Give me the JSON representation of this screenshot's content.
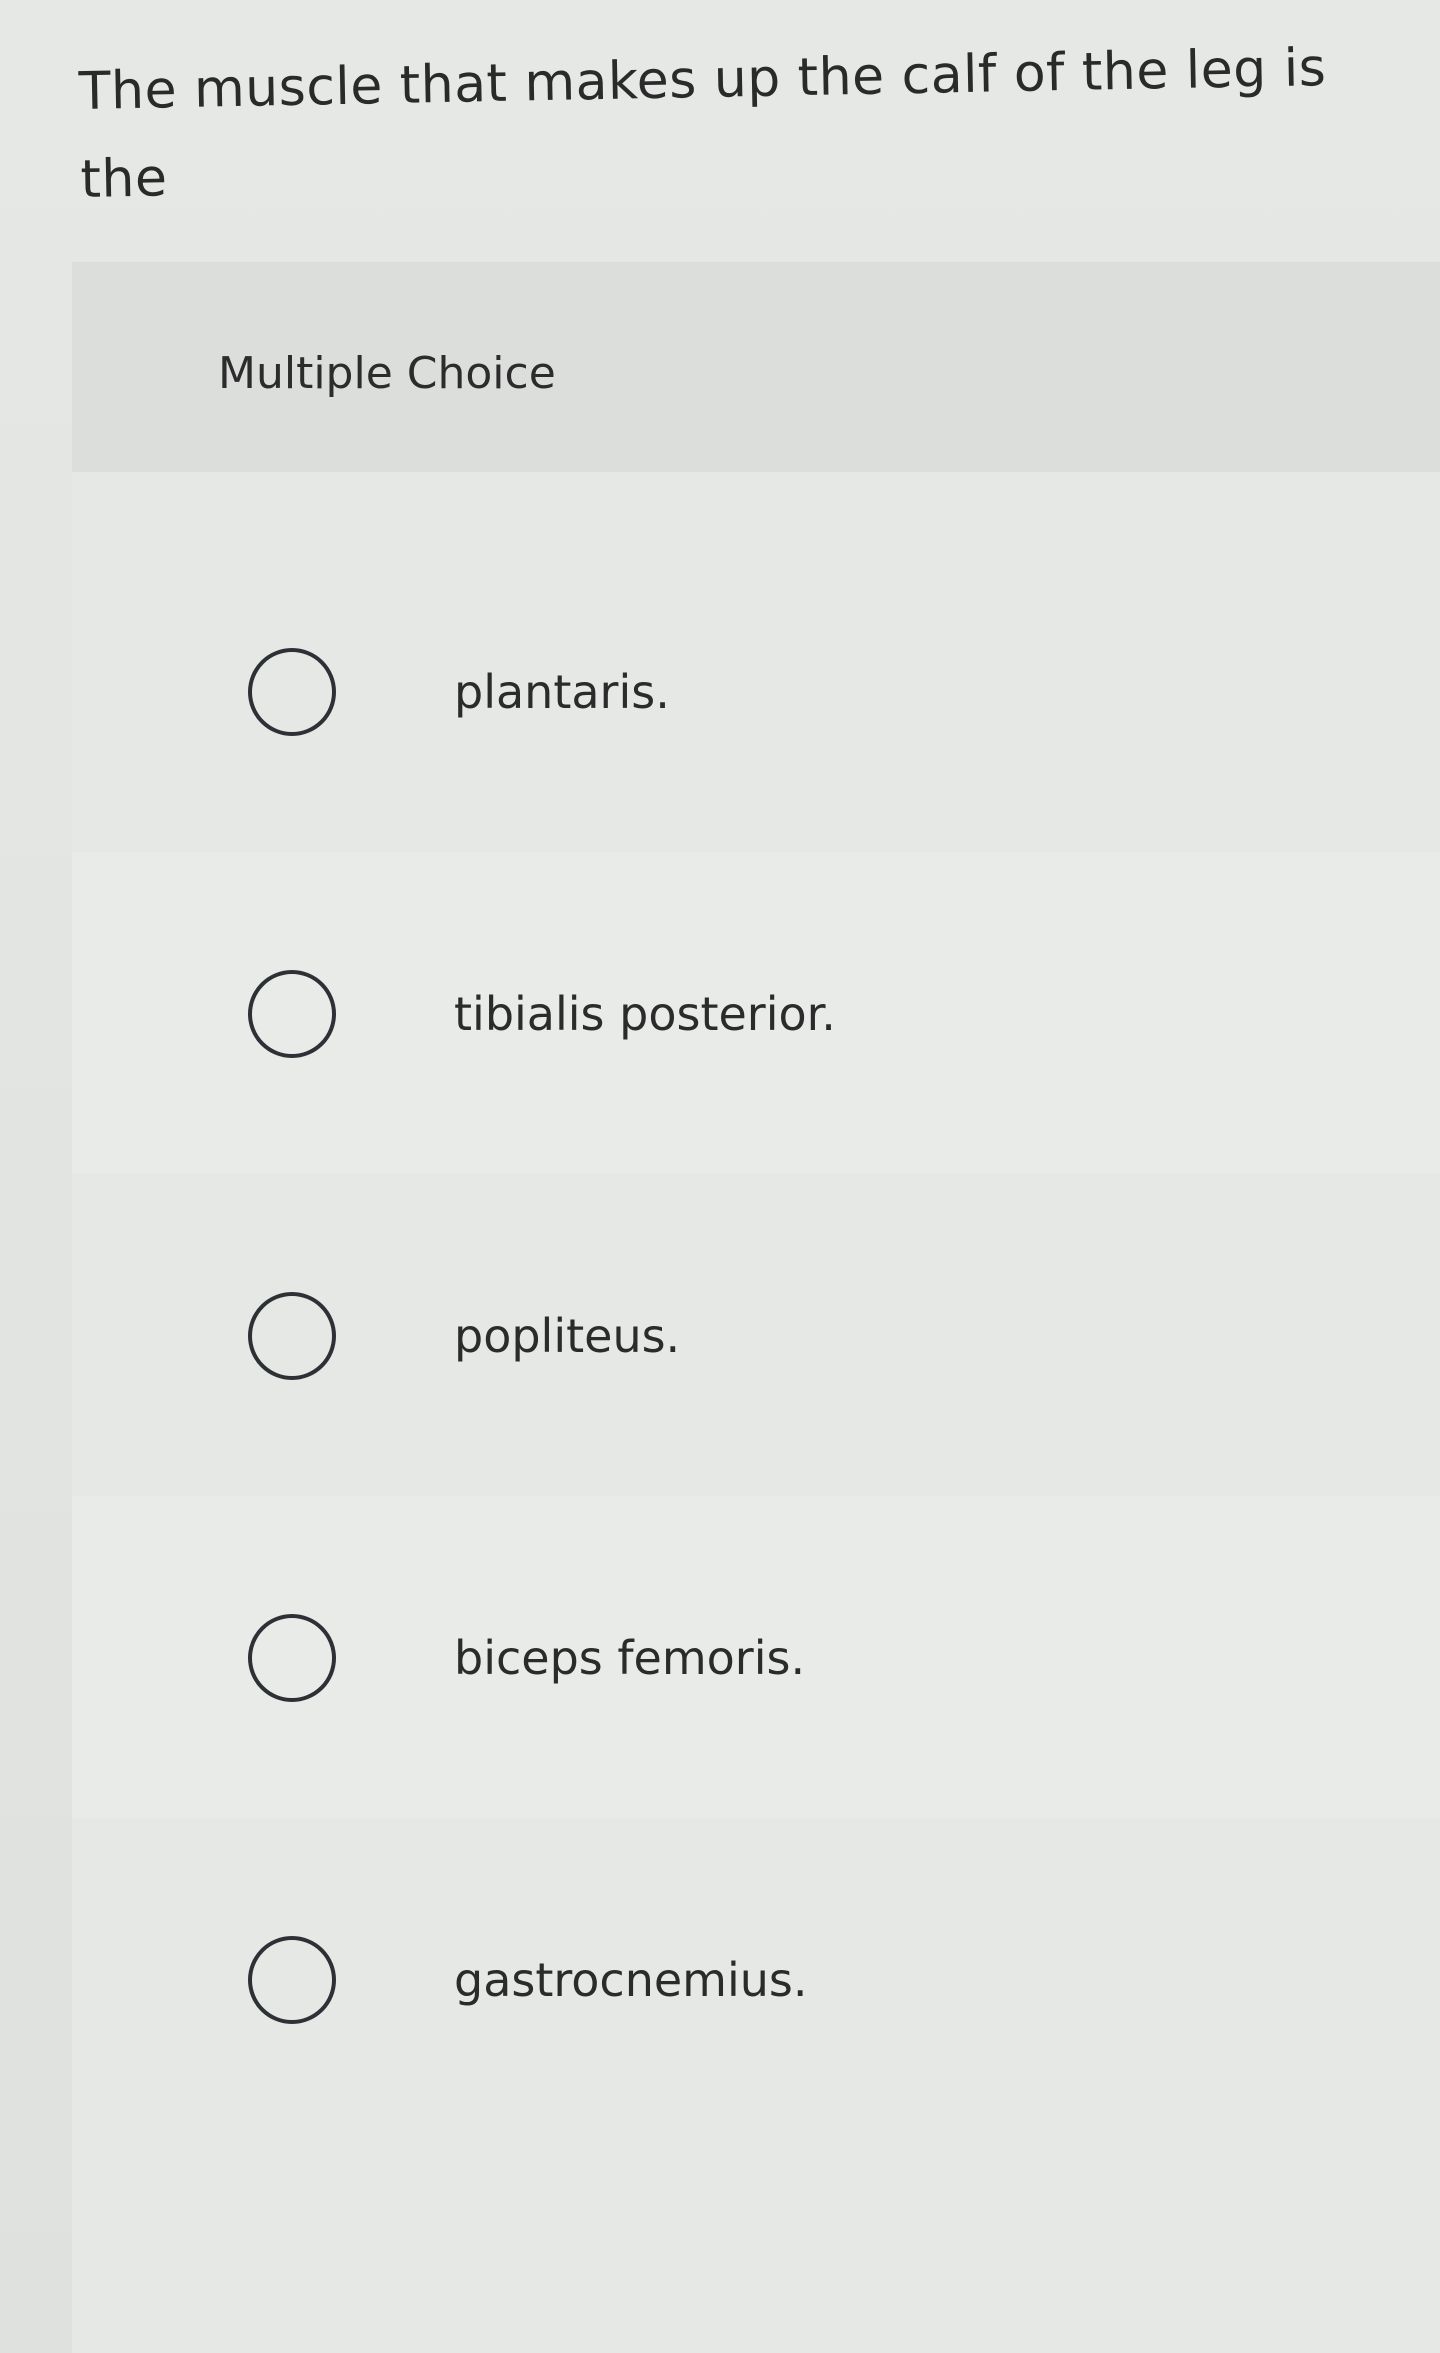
{
  "question": {
    "text": "The muscle that makes up the calf of the leg is the"
  },
  "panel": {
    "title": "Multiple Choice"
  },
  "choices": [
    {
      "label": "plantaris.",
      "selected": false
    },
    {
      "label": "tibialis posterior.",
      "selected": false
    },
    {
      "label": "popliteus.",
      "selected": false
    },
    {
      "label": "biceps femoris.",
      "selected": false
    },
    {
      "label": "gastrocnemius.",
      "selected": false
    }
  ]
}
